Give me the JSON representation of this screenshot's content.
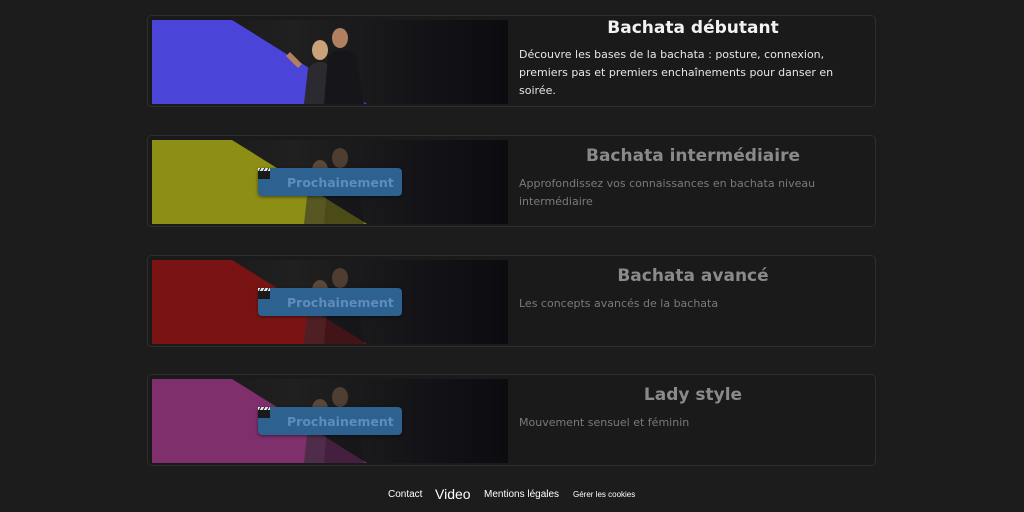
{
  "courses": [
    {
      "title": "Bachata débutant",
      "description": "Découvre les bases de la bachata : posture, connexion, premiers pas et premiers enchaînements pour danser en soirée.",
      "accent_color": "#4a44d9",
      "locked": false
    },
    {
      "title": "Bachata intermédiaire",
      "description": "Approfondissez vos connaissances en bachata niveau intermédiaire",
      "accent_color": "#8d8e15",
      "locked": true,
      "badge_label": "Prochainement",
      "badge_icon": "clapperboard-icon"
    },
    {
      "title": "Bachata avancé",
      "description": "Les concepts avancés de la bachata",
      "accent_color": "#7a1414",
      "locked": true,
      "badge_label": "Prochainement",
      "badge_icon": "clapperboard-icon"
    },
    {
      "title": "Lady style",
      "description": "Mouvement sensuel et féminin",
      "accent_color": "#7e2f6c",
      "locked": true,
      "badge_label": "Prochainement",
      "badge_icon": "clapperboard-icon"
    }
  ],
  "footer": {
    "contact": "Contact",
    "video": "Video",
    "legal": "Mentions légales",
    "cookies": "Gérer les cookies"
  },
  "colors": {
    "background": "#1c1c1c",
    "badge_background": "#2d6190",
    "badge_text": "#5f8dbb"
  }
}
